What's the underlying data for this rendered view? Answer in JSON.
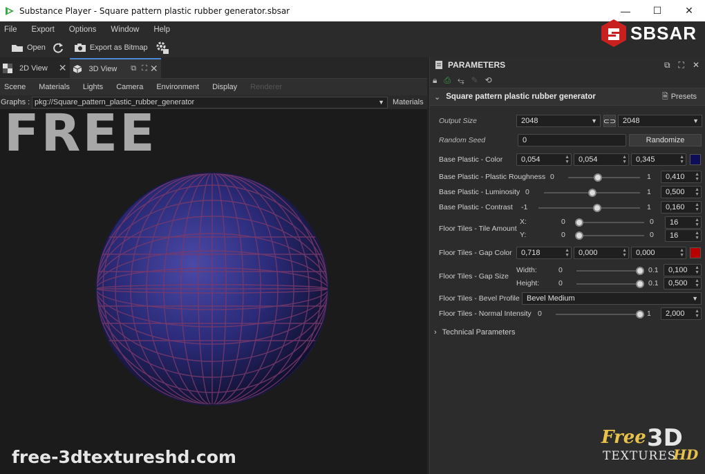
{
  "window": {
    "title": "Substance Player - Square pattern plastic rubber generator.sbsar",
    "minimize": "—",
    "maximize": "☐",
    "close": "✕"
  },
  "menu": [
    "File",
    "Export",
    "Options",
    "Window",
    "Help"
  ],
  "toolbar": {
    "open": "Open",
    "export": "Export as Bitmap"
  },
  "brand": {
    "sbsar": "SBSAR"
  },
  "tabs": [
    {
      "label": "2D View"
    },
    {
      "label": "3D View"
    }
  ],
  "viewmenu": [
    "Scene",
    "Materials",
    "Lights",
    "Camera",
    "Environment",
    "Display",
    "Renderer"
  ],
  "graphs": {
    "label": "Graphs :",
    "value": "pkg://Square_pattern_plastic_rubber_generator",
    "right": "Materials"
  },
  "viewport": {
    "overlay": "FREE",
    "watermark": "free-3dtextureshd.com"
  },
  "params": {
    "header": "PARAMETERS",
    "graph_name": "Square pattern plastic rubber generator",
    "presets": "Presets",
    "output_size": {
      "label": "Output Size",
      "w": "2048",
      "h": "2048"
    },
    "random_seed": {
      "label": "Random Seed",
      "value": "0",
      "button": "Randomize"
    },
    "base_color": {
      "label": "Base Plastic  - Color",
      "r": "0,054",
      "g": "0,054",
      "b": "0,345",
      "swatch": "#0d0d58"
    },
    "roughness": {
      "label": "Base Plastic  - Plastic Roughness",
      "min": "0",
      "max": "1",
      "value": "0,410",
      "fraction": 0.41
    },
    "luminosity": {
      "label": "Base Plastic  - Luminosity",
      "min": "0",
      "max": "1",
      "value": "0,500",
      "fraction": 0.5
    },
    "contrast": {
      "label": "Base Plastic  - Contrast",
      "min": "-1",
      "max": "1",
      "value": "0,160",
      "fraction": 0.58
    },
    "tile_amount": {
      "label": "Floor Tiles - Tile Amount",
      "x_label": "X:",
      "y_label": "Y:",
      "x_min": "0",
      "x_max": "0",
      "x_value": "16",
      "y_min": "0",
      "y_max": "0",
      "y_value": "16"
    },
    "gap_color": {
      "label": "Floor Tiles - Gap Color",
      "r": "0,718",
      "g": "0,000",
      "b": "0,000",
      "swatch": "#b70000"
    },
    "gap_size": {
      "label": "Floor Tiles - Gap Size",
      "w_label": "Width:",
      "h_label": "Height:",
      "w_min": "0",
      "w_max": "0.1",
      "w_value": "0,100",
      "h_min": "0",
      "h_max": "0.1",
      "h_value": "0,500"
    },
    "bevel_profile": {
      "label": "Floor Tiles - Bevel Profile",
      "value": "Bevel Medium"
    },
    "normal_intensity": {
      "label": "Floor Tiles - Normal Intensity",
      "min": "0",
      "max": "1",
      "value": "2,000",
      "fraction": 1.0
    },
    "technical": "Technical Parameters"
  },
  "logo": {
    "free": "Free",
    "three_d": "3D",
    "textures": "TEXTURES",
    "hd": "HD"
  }
}
